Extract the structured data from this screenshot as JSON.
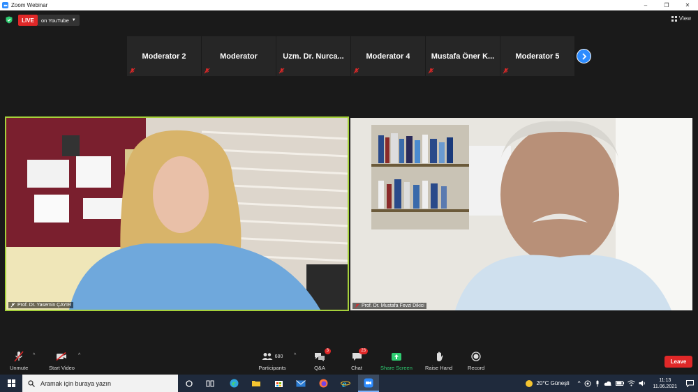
{
  "window": {
    "title": "Zoom Webinar",
    "controls": [
      "–",
      "❐",
      "✕"
    ]
  },
  "header": {
    "live_label": "LIVE",
    "stream_label": "on YouTube",
    "view_label": "View"
  },
  "gallery": {
    "tiles": [
      {
        "name": "Moderator 2"
      },
      {
        "name": "Moderator"
      },
      {
        "name": "Uzm. Dr. Nurca..."
      },
      {
        "name": "Moderator 4"
      },
      {
        "name": "Mustafa  Öner  K..."
      },
      {
        "name": "Moderator 5"
      }
    ]
  },
  "videos": {
    "left": {
      "name": "Prof. Dr. Yasemin ÇAYIR",
      "active_speaker_color": "#a6d13b"
    },
    "right": {
      "name": "Prof. Dr. Mustafa Fevzi Dikici"
    }
  },
  "toolbar": {
    "unmute": "Unmute",
    "start_video": "Start Video",
    "participants": "Participants",
    "participants_count": "680",
    "qa": "Q&A",
    "qa_badge": "3",
    "chat": "Chat",
    "chat_badge": "23",
    "share_screen": "Share Screen",
    "raise_hand": "Raise Hand",
    "record": "Record",
    "leave": "Leave"
  },
  "taskbar": {
    "search_placeholder": "Aramak için buraya yazın",
    "weather": "20°C  Güneşli",
    "time": "11:13",
    "date": "11.06.2021"
  },
  "colors": {
    "accent": "#2d8cff",
    "live": "#e02828",
    "share": "#2ecc71",
    "speaker_border": "#a6d13b"
  }
}
